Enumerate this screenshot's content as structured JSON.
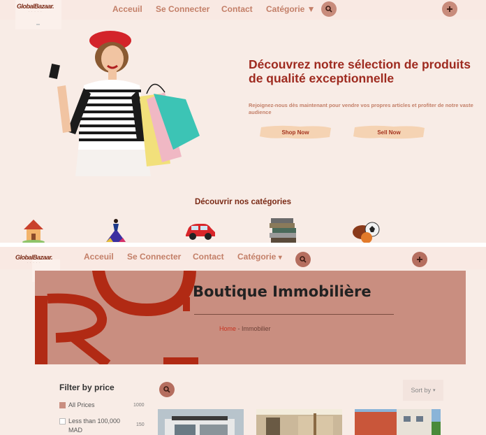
{
  "top": {
    "logo": "GlobalBazaar.",
    "logo_tag": "· · · · ·",
    "nav": {
      "home": "Acceuil",
      "login": "Se Connecter",
      "contact": "Contact",
      "category": "Catégorie ▼"
    },
    "hero": {
      "title": "Découvrez notre sélection de produits de qualité exceptionnelle",
      "subtitle": "Rejoignez-nous dès maintenant pour vendre vos propres articles et profiter de notre vaste audience",
      "shop_now": "Shop Now",
      "sell_now": "Sell Now"
    },
    "categories_title": "Découvrir nos catégories",
    "category_icons": [
      "house-icon",
      "dress-icon",
      "car-icon",
      "books-icon",
      "sports-balls-icon"
    ]
  },
  "bottom": {
    "logo": "GlobalBazaar.",
    "logo_tag": "· · · · ·",
    "nav": {
      "home": "Acceuil",
      "login": "Se Connecter",
      "contact": "Contact",
      "category": "Catégorie"
    },
    "banner": {
      "title": "Boutique Immobilière",
      "crumb_home": "Home",
      "crumb_sep": "-",
      "crumb_current": "Immobilier"
    },
    "filter": {
      "title": "Filter by price",
      "options": [
        {
          "label": "All Prices",
          "count": "1000",
          "checked": true
        },
        {
          "label": "Less than 100,000",
          "label2": "MAD",
          "count": "150",
          "checked": false
        }
      ]
    },
    "sort_label": "Sort by"
  },
  "colors": {
    "accent": "#9e2a1f",
    "nav_text": "#c37f68",
    "banner_bg": "#c98e80",
    "page_bg": "#f8ece6",
    "button_brush": "#f5d3b3"
  }
}
